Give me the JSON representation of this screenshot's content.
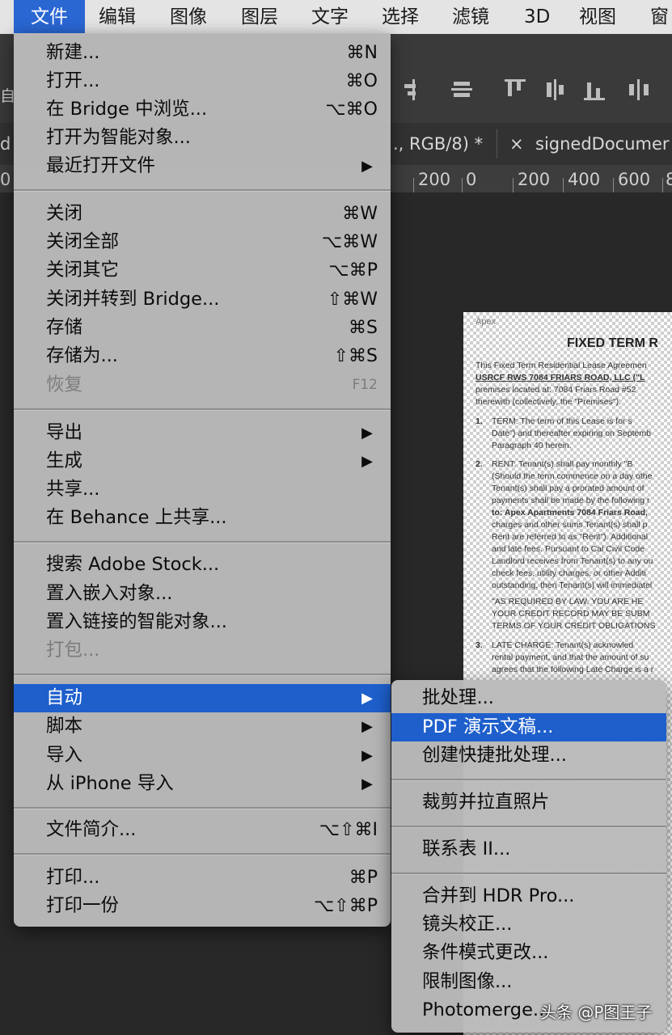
{
  "menubar": {
    "items": [
      "文件",
      "编辑",
      "图像",
      "图层",
      "文字",
      "选择",
      "滤镜",
      "3D",
      "视图",
      "窗"
    ]
  },
  "options_bar": {
    "partial_label": "自"
  },
  "tabs": {
    "left_partial": "d",
    "active_partial": "., RGB/8) *",
    "close_glyph": "×",
    "second_title": "signedDocumer"
  },
  "ruler": {
    "labels": [
      "0",
      "200",
      "0",
      "200",
      "400",
      "600",
      "8"
    ]
  },
  "file_menu": {
    "groups": [
      [
        {
          "label": "新建...",
          "shortcut": "⌘N"
        },
        {
          "label": "打开...",
          "shortcut": "⌘O"
        },
        {
          "label": "在 Bridge 中浏览...",
          "shortcut": "⌥⌘O"
        },
        {
          "label": "打开为智能对象..."
        },
        {
          "label": "最近打开文件",
          "submenu": true
        }
      ],
      [
        {
          "label": "关闭",
          "shortcut": "⌘W"
        },
        {
          "label": "关闭全部",
          "shortcut": "⌥⌘W"
        },
        {
          "label": "关闭其它",
          "shortcut": "⌥⌘P"
        },
        {
          "label": "关闭并转到 Bridge...",
          "shortcut": "⇧⌘W"
        },
        {
          "label": "存储",
          "shortcut": "⌘S"
        },
        {
          "label": "存储为...",
          "shortcut": "⇧⌘S"
        },
        {
          "label": "恢复",
          "shortcut": "F12",
          "disabled": true
        }
      ],
      [
        {
          "label": "导出",
          "submenu": true
        },
        {
          "label": "生成",
          "submenu": true
        },
        {
          "label": "共享..."
        },
        {
          "label": "在 Behance 上共享..."
        }
      ],
      [
        {
          "label": "搜索 Adobe Stock..."
        },
        {
          "label": "置入嵌入对象..."
        },
        {
          "label": "置入链接的智能对象..."
        },
        {
          "label": "打包...",
          "disabled": true
        }
      ],
      [
        {
          "label": "自动",
          "submenu": true,
          "highlighted": true
        },
        {
          "label": "脚本",
          "submenu": true
        },
        {
          "label": "导入",
          "submenu": true
        },
        {
          "label": "从 iPhone 导入",
          "submenu": true
        }
      ],
      [
        {
          "label": "文件简介...",
          "shortcut": "⌥⇧⌘I"
        }
      ],
      [
        {
          "label": "打印...",
          "shortcut": "⌘P"
        },
        {
          "label": "打印一份",
          "shortcut": "⌥⇧⌘P"
        }
      ]
    ]
  },
  "auto_submenu": {
    "groups": [
      [
        {
          "label": "批处理..."
        },
        {
          "label": "PDF 演示文稿...",
          "highlighted": true
        },
        {
          "label": "创建快捷批处理..."
        }
      ],
      [
        {
          "label": "裁剪并拉直照片"
        }
      ],
      [
        {
          "label": "联系表 II..."
        }
      ],
      [
        {
          "label": "合并到 HDR Pro..."
        },
        {
          "label": "镜头校正..."
        },
        {
          "label": "条件模式更改..."
        },
        {
          "label": "限制图像..."
        },
        {
          "label": "Photomerge..."
        }
      ]
    ]
  },
  "document": {
    "header": "Apex",
    "title": "FIXED TERM R",
    "intro": [
      "This Fixed Term Residential Lease Agreemen",
      "USRCF RWS 7084 FRIARS ROAD, LLC (\"L",
      "premises located at: 7084 Friars Road #52",
      "therewith (collectively, the \"Premises\")."
    ],
    "sections": [
      {
        "num": "1.",
        "lines": [
          "TERM:      The term of this Lease is for s",
          "Date\") and thereafter expiring on Septemb",
          "Paragraph 40 herein."
        ]
      },
      {
        "num": "2.",
        "lines": [
          "RENT:      Tenant(s) shall pay monthly \"B",
          "(Should the term commence on a day othe",
          "Tenant(s) shall pay a prorated amount of",
          "payments shall be made by the following r",
          "to: Apex Apartments 7084 Friars Road,",
          "charges and other sums Tenant(s) shall p",
          "Rent are referred to as \"Rent\"). Additional",
          "and late fees. Pursuant to Cal Civil Code",
          "Landlord receives from Tenant(s) to any ou",
          "check fees, utility charges, or other Additi",
          "outstanding, then Tenant(s) will immediatel",
          "\"AS REQUIRED BY LAW, YOU ARE HE",
          "YOUR CREDIT RECORD MAY BE SUBM",
          "TERMS OF YOUR CREDIT OBLIGATIONS"
        ]
      },
      {
        "num": "3.",
        "lines": [
          "LATE CHARGE:      Tenant(s) acknowled",
          "rental payment, and that the amount of su",
          "agrees that the following Late Charge is a r"
        ]
      }
    ]
  },
  "watermark": "头条 @P图王子"
}
